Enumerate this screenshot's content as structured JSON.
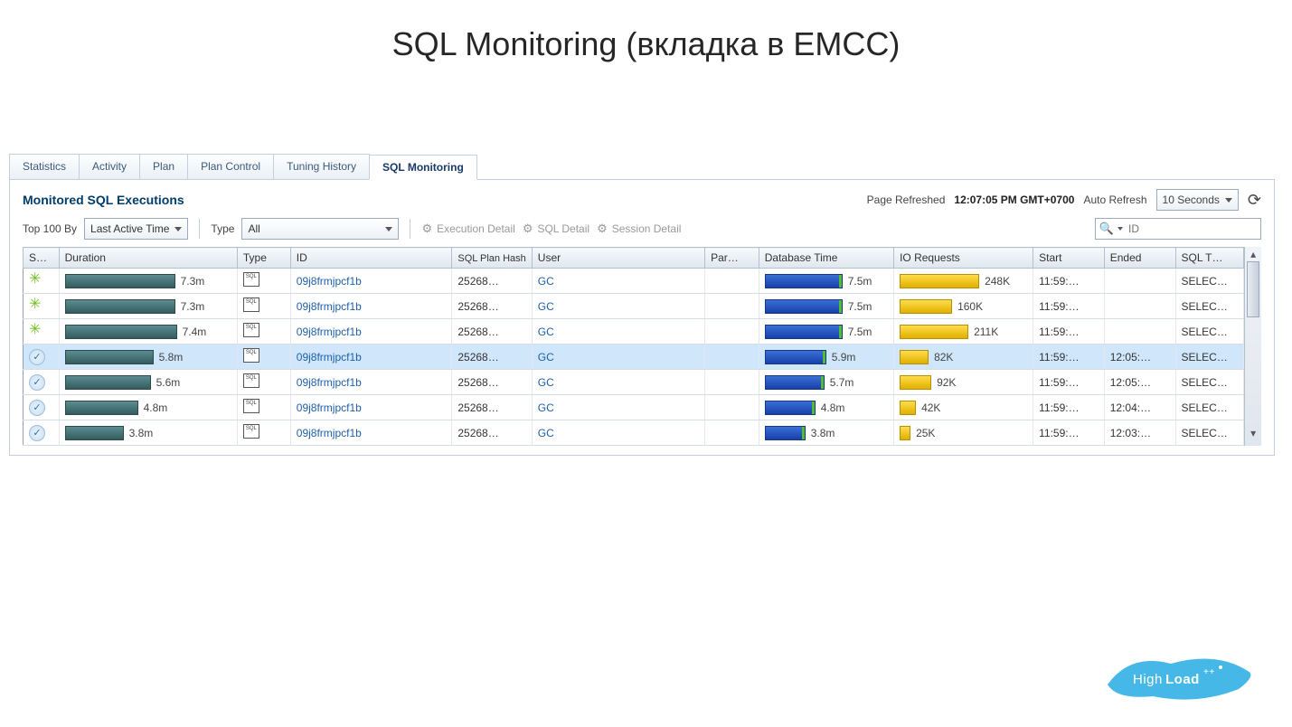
{
  "title": "SQL Monitoring (вкладка в EMCC)",
  "tabs": [
    "Statistics",
    "Activity",
    "Plan",
    "Plan Control",
    "Tuning History",
    "SQL Monitoring"
  ],
  "active_tab": 5,
  "panel_title": "Monitored SQL Executions",
  "page_refreshed_label": "Page Refreshed",
  "page_refreshed_time": "12:07:05 PM GMT+0700",
  "auto_refresh_label": "Auto Refresh",
  "auto_refresh_value": "10 Seconds",
  "toolbar": {
    "top100_label": "Top 100 By",
    "top100_value": "Last Active Time",
    "type_label": "Type",
    "type_value": "All",
    "exec_detail": "Execution Detail",
    "sql_detail": "SQL Detail",
    "session_detail": "Session Detail",
    "search_placeholder": "ID"
  },
  "columns": {
    "status": "S…",
    "duration": "Duration",
    "type": "Type",
    "id": "ID",
    "hash": "SQL Plan Hash",
    "user": "User",
    "par": "Par…",
    "db": "Database Time",
    "io": "IO Requests",
    "start": "Start",
    "ended": "Ended",
    "sqlt": "SQL T…"
  },
  "rows": [
    {
      "status": "run",
      "dur_w": 120,
      "dur": "7.3m",
      "id": "09j8frmjpcf1b",
      "hash": "25268…",
      "user": "GC",
      "db_w": 84,
      "db": "7.5m",
      "io_w": 86,
      "io": "248K",
      "start": "11:59:…",
      "ended": "",
      "sqlt": "SELEC…"
    },
    {
      "status": "run",
      "dur_w": 120,
      "dur": "7.3m",
      "id": "09j8frmjpcf1b",
      "hash": "25268…",
      "user": "GC",
      "db_w": 84,
      "db": "7.5m",
      "io_w": 56,
      "io": "160K",
      "start": "11:59:…",
      "ended": "",
      "sqlt": "SELEC…"
    },
    {
      "status": "run",
      "dur_w": 122,
      "dur": "7.4m",
      "id": "09j8frmjpcf1b",
      "hash": "25268…",
      "user": "GC",
      "db_w": 84,
      "db": "7.5m",
      "io_w": 74,
      "io": "211K",
      "start": "11:59:…",
      "ended": "",
      "sqlt": "SELEC…"
    },
    {
      "status": "done",
      "sel": true,
      "dur_w": 96,
      "dur": "5.8m",
      "id": "09j8frmjpcf1b",
      "hash": "25268…",
      "user": "GC",
      "db_w": 66,
      "db": "5.9m",
      "io_w": 30,
      "io": "82K",
      "start": "11:59:…",
      "ended": "12:05:…",
      "sqlt": "SELEC…"
    },
    {
      "status": "done",
      "dur_w": 93,
      "dur": "5.6m",
      "id": "09j8frmjpcf1b",
      "hash": "25268…",
      "user": "GC",
      "db_w": 64,
      "db": "5.7m",
      "io_w": 33,
      "io": "92K",
      "start": "11:59:…",
      "ended": "12:05:…",
      "sqlt": "SELEC…"
    },
    {
      "status": "done",
      "dur_w": 79,
      "dur": "4.8m",
      "id": "09j8frmjpcf1b",
      "hash": "25268…",
      "user": "GC",
      "db_w": 54,
      "db": "4.8m",
      "io_w": 16,
      "io": "42K",
      "start": "11:59:…",
      "ended": "12:04:…",
      "sqlt": "SELEC…"
    },
    {
      "status": "done",
      "dur_w": 63,
      "dur": "3.8m",
      "id": "09j8frmjpcf1b",
      "hash": "25268…",
      "user": "GC",
      "db_w": 43,
      "db": "3.8m",
      "io_w": 10,
      "io": "25K",
      "start": "11:59:…",
      "ended": "12:03:…",
      "sqlt": "SELEC…"
    }
  ],
  "watermark": "HighLoad"
}
